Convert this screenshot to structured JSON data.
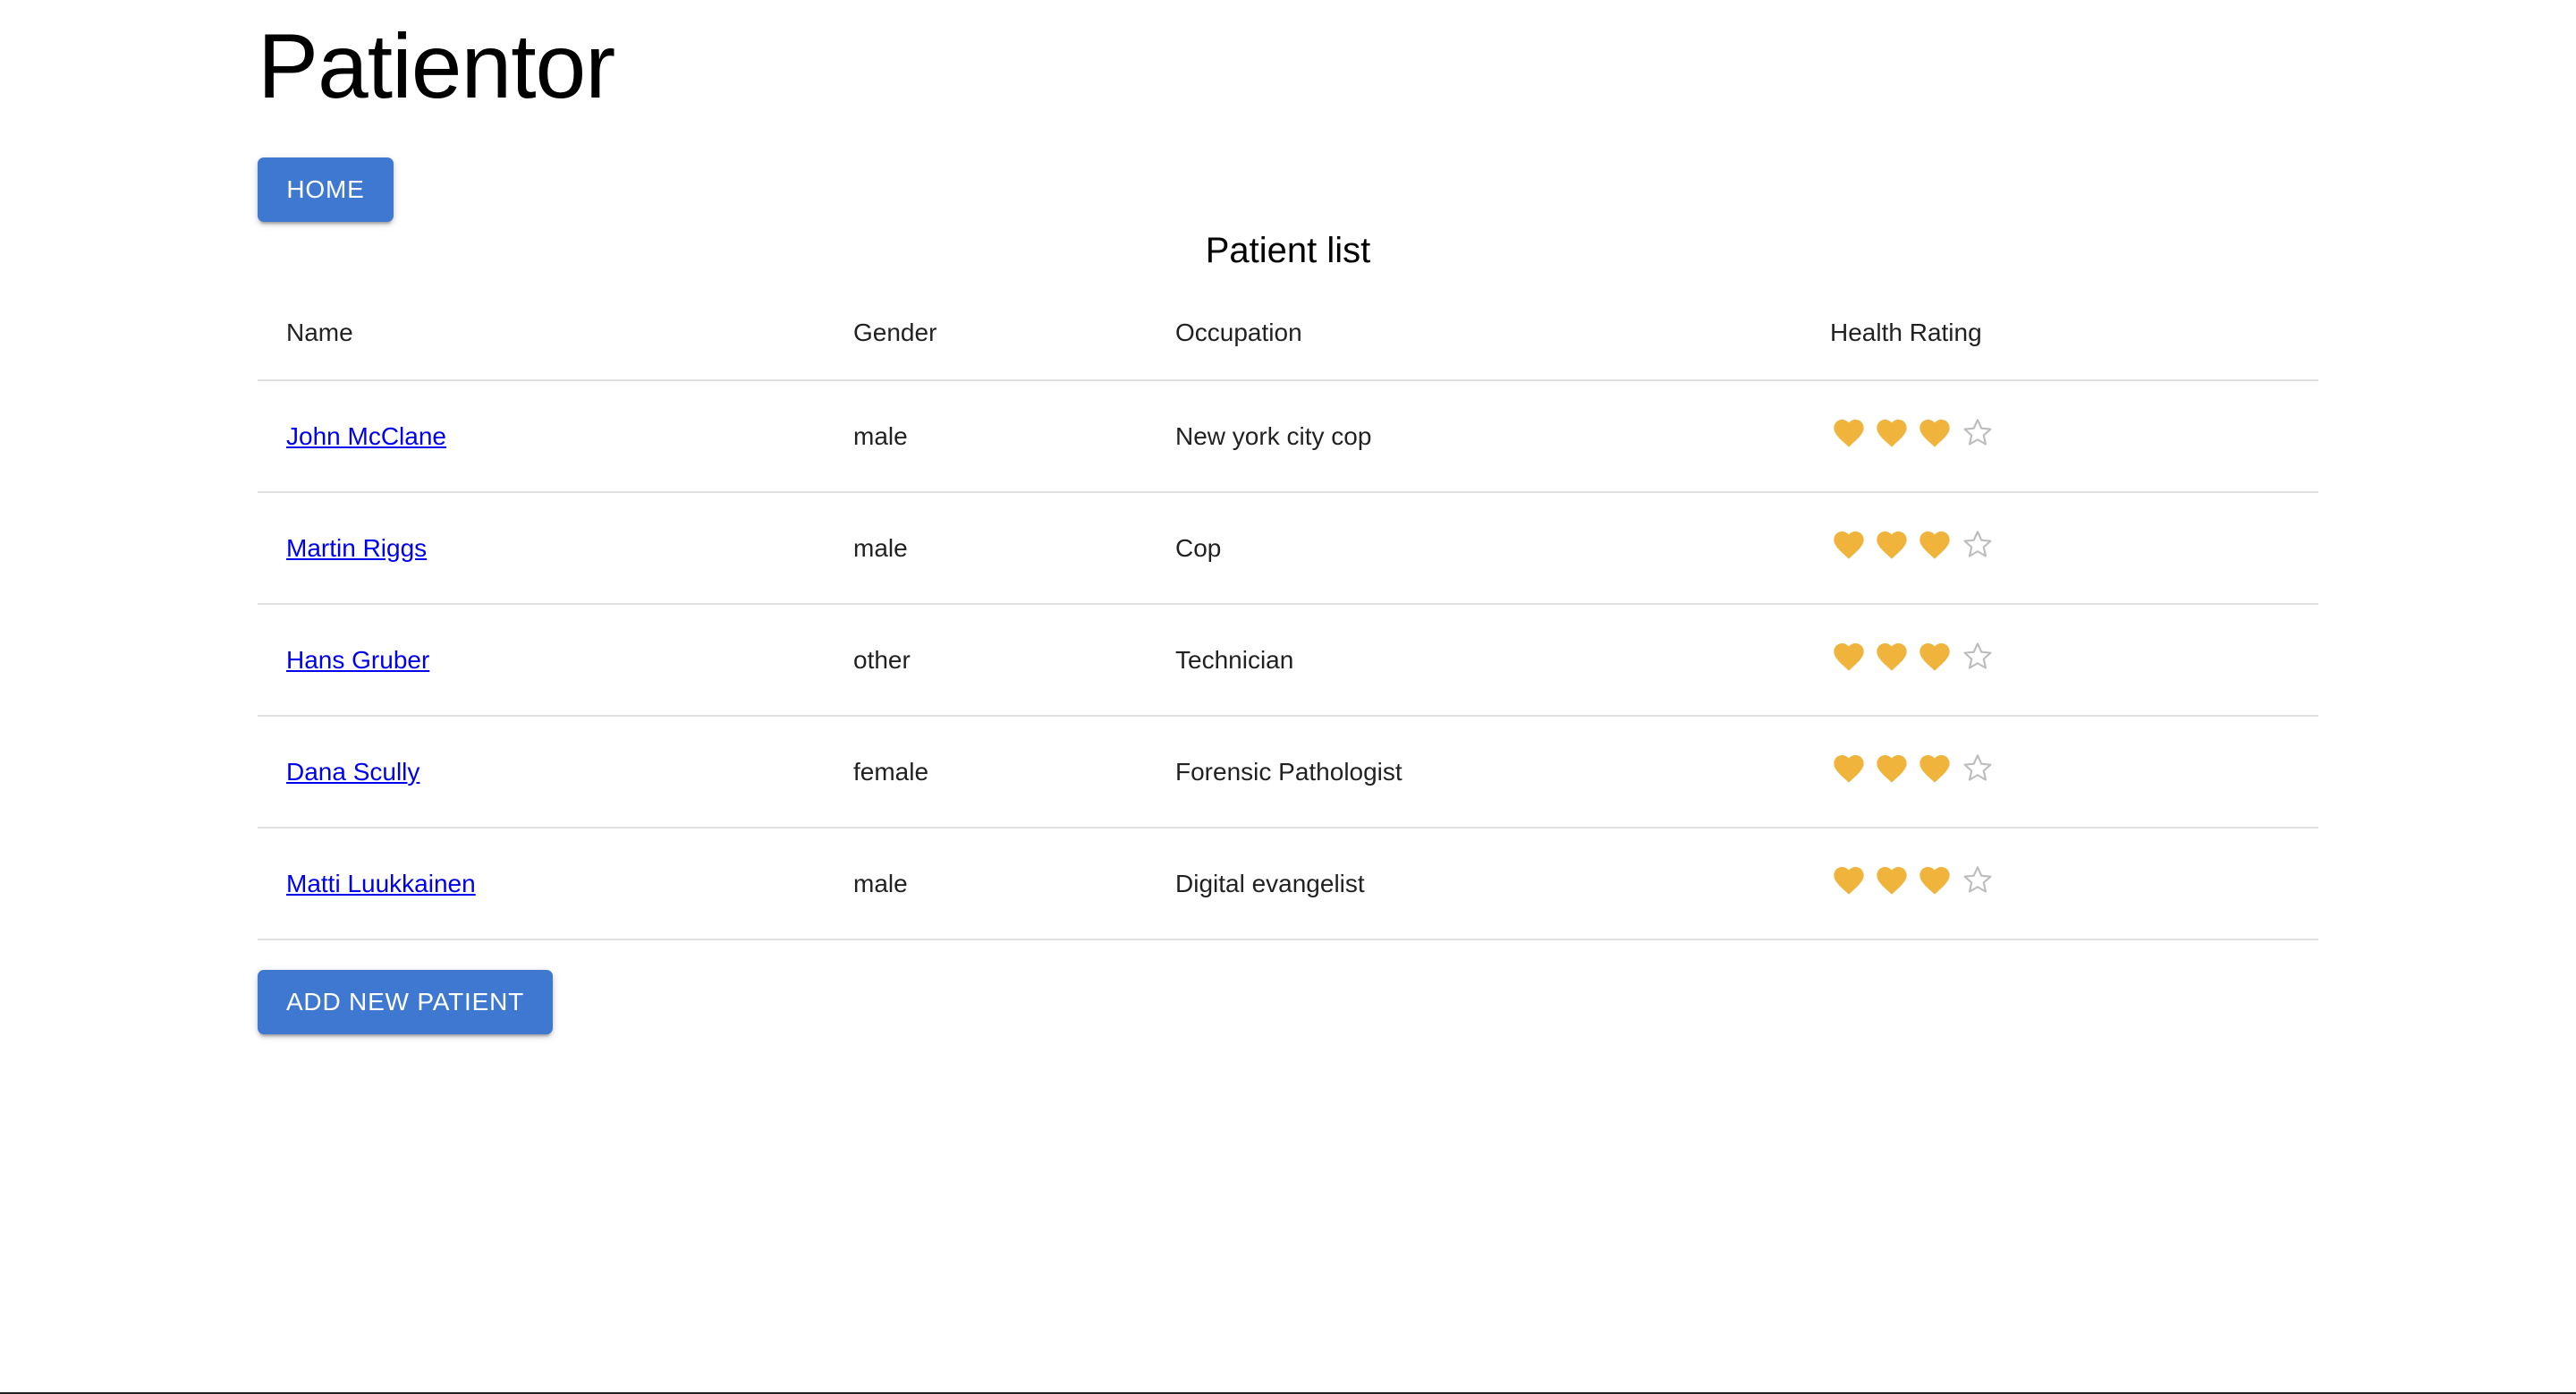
{
  "app": {
    "title": "Patientor"
  },
  "nav": {
    "home_label": "Home"
  },
  "patient_list": {
    "title": "Patient list",
    "columns": [
      "Name",
      "Gender",
      "Occupation",
      "Health Rating"
    ],
    "rows": [
      {
        "name": "John McClane",
        "gender": "male",
        "occupation": "New york city cop",
        "health_rating": 3,
        "rating_max": 4
      },
      {
        "name": "Martin Riggs",
        "gender": "male",
        "occupation": "Cop",
        "health_rating": 3,
        "rating_max": 4
      },
      {
        "name": "Hans Gruber",
        "gender": "other",
        "occupation": "Technician",
        "health_rating": 3,
        "rating_max": 4
      },
      {
        "name": "Dana Scully",
        "gender": "female",
        "occupation": "Forensic Pathologist",
        "health_rating": 3,
        "rating_max": 4
      },
      {
        "name": "Matti Luukkainen",
        "gender": "male",
        "occupation": "Digital evangelist",
        "health_rating": 3,
        "rating_max": 4
      }
    ]
  },
  "actions": {
    "add_patient_label": "Add New Patient"
  },
  "icons": {
    "filled": "heart-icon",
    "empty": "star-outline-icon"
  },
  "colors": {
    "primary": "#3f78d0",
    "heart": "#f0b43c",
    "empty_star": "#bdbdbd",
    "link": "#0000ee"
  }
}
